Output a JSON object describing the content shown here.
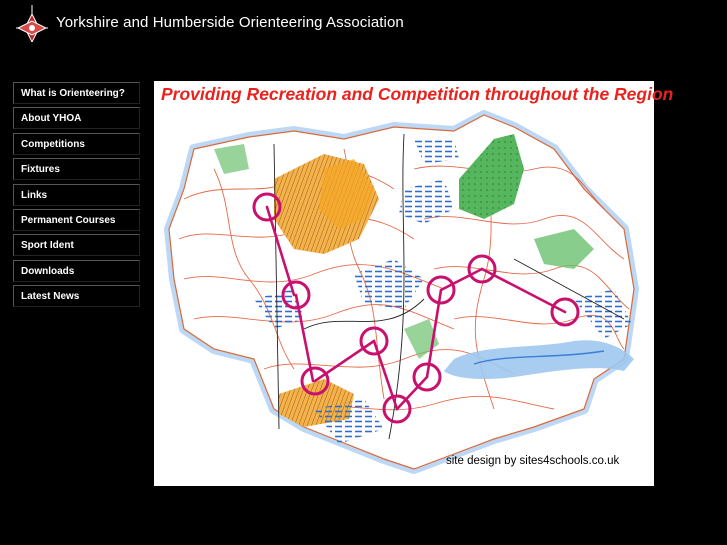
{
  "header": {
    "title": "Yorkshire and Humberside Orienteering Association",
    "logo_icon": "compass-rose-logo-icon"
  },
  "nav": {
    "items": [
      {
        "label": "What is Orienteering?"
      },
      {
        "label": "About YHOA"
      },
      {
        "label": "Competitions"
      },
      {
        "label": "Fixtures"
      },
      {
        "label": "Links"
      },
      {
        "label": "Permanent Courses"
      },
      {
        "label": "Sport Ident"
      },
      {
        "label": "Downloads"
      },
      {
        "label": "Latest News"
      }
    ]
  },
  "main": {
    "tagline": "Providing Recreation and Competition throughout the Region",
    "credit": "site design by sites4schools.co.uk"
  },
  "colors": {
    "background": "#000000",
    "tagline": "#e8231f",
    "course_line": "#c8106e",
    "contour": "#e0502a",
    "water": "#3b7fd6",
    "forest": "#4fae5a",
    "open_land": "#f0a030"
  }
}
